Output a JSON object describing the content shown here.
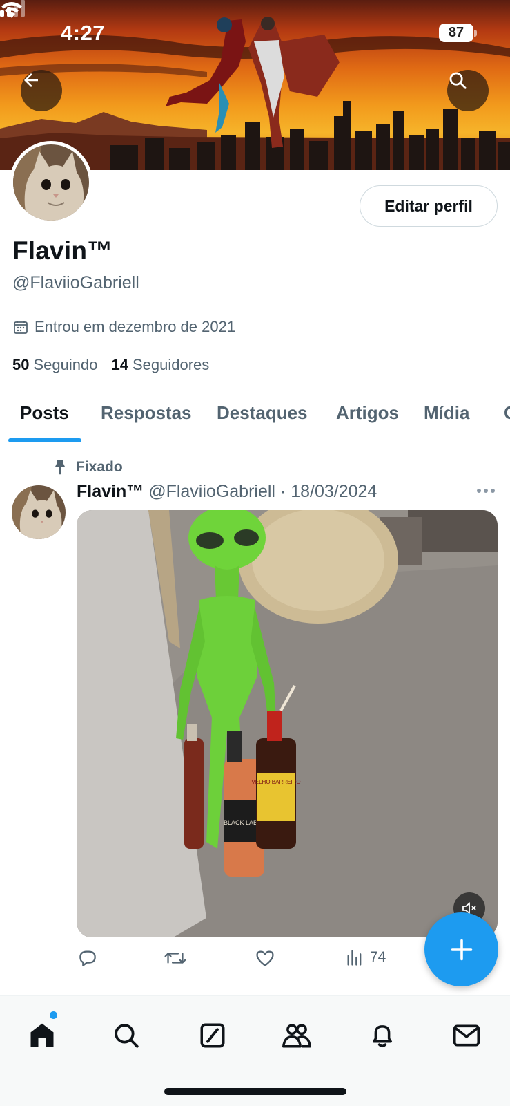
{
  "status_bar": {
    "time": "4:27",
    "battery": "87"
  },
  "profile": {
    "display_name": "Flavin™",
    "handle": "@FlaviioGabriell",
    "edit_button": "Editar perfil",
    "joined": "Entrou em dezembro de 2021",
    "following_count": "50",
    "following_label": "Seguindo",
    "followers_count": "14",
    "followers_label": "Seguidores"
  },
  "tabs": [
    {
      "label": "Posts",
      "active": true
    },
    {
      "label": "Respostas",
      "active": false
    },
    {
      "label": "Destaques",
      "active": false
    },
    {
      "label": "Artigos",
      "active": false
    },
    {
      "label": "Mídia",
      "active": false
    },
    {
      "label": "C",
      "active": false
    }
  ],
  "post": {
    "pinned_label": "Fixado",
    "author_name": "Flavin™",
    "author_handle": "@FlaviioGabriell",
    "separator": "·",
    "date": "18/03/2024",
    "views": "74",
    "media_labels": {
      "bottle_label": "BLACK LABEL",
      "bottle_label_2": "VELHO BARREIRO"
    }
  },
  "icons": {
    "back": "arrow-left-icon",
    "search": "search-icon",
    "pin": "pin-icon",
    "calendar": "calendar-icon",
    "more": "more-dots-icon",
    "reply": "reply-icon",
    "retweet": "retweet-icon",
    "like": "heart-icon",
    "views": "views-chart-icon",
    "compose": "plus-icon",
    "mute": "mute-icon"
  },
  "bottom_nav": [
    "home",
    "search",
    "grok",
    "communities",
    "notifications",
    "messages"
  ],
  "colors": {
    "accent": "#1d9bf0",
    "text": "#0f1419",
    "secondary": "#536471"
  }
}
